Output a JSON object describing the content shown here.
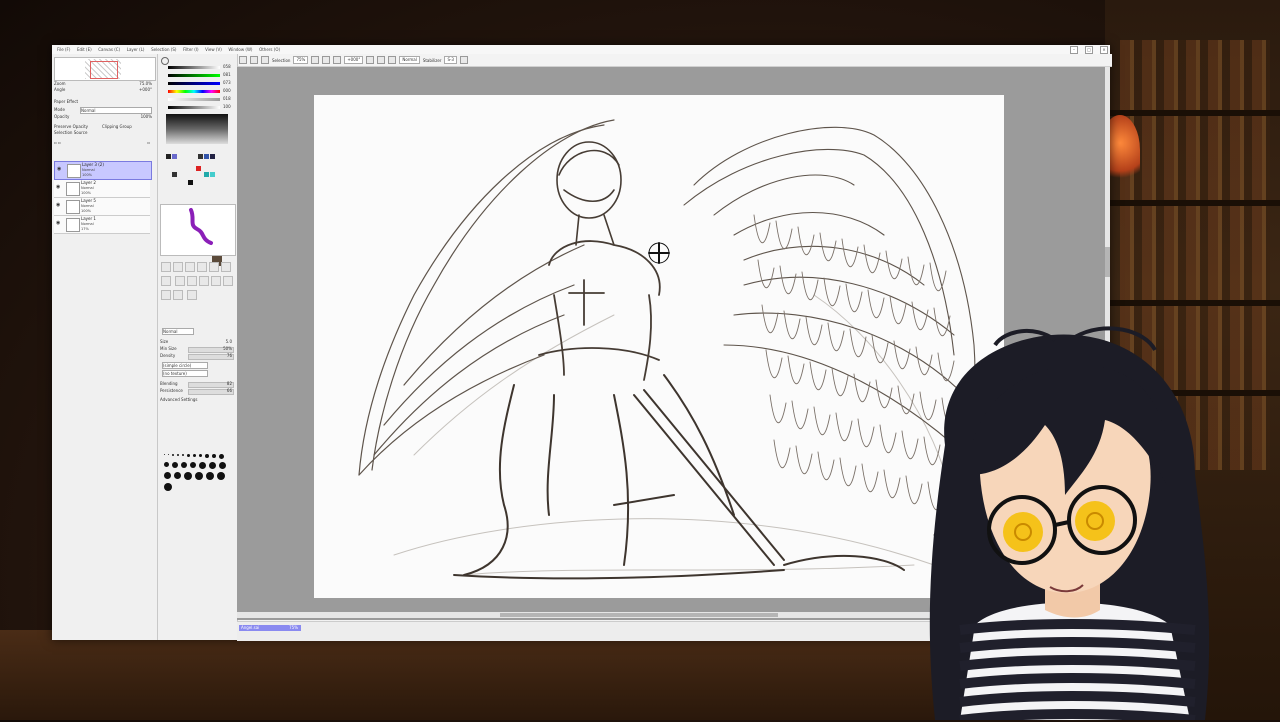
{
  "menu": [
    "File (F)",
    "Edit (E)",
    "Canvas (C)",
    "Layer (L)",
    "Selection (S)",
    "Filter (I)",
    "View (V)",
    "Window (W)",
    "Others (O)"
  ],
  "toolbar": {
    "selection_label": "Selection",
    "zoom_value": "75%",
    "rotation_value": "+000°",
    "mode_value": "Normal",
    "stabilizer_label": "Stabilizer",
    "stabilizer_value": "S-3"
  },
  "navigator": {
    "zoom_label": "Zoom",
    "zoom_value": "75.0%",
    "angle_label": "Angle",
    "angle_value": "+000°"
  },
  "layer_panel": {
    "effect_label": "Paper Effect",
    "mode_label": "Mode",
    "mode_value": "Normal",
    "opacity_label": "Opacity",
    "opacity_value": "100%",
    "preserve_opacity": "Preserve Opacity",
    "clipping_group": "Clipping Group",
    "selection_source": "Selection Source",
    "layers": [
      {
        "name": "Layer 3 (2)",
        "mode": "Normal",
        "opacity": "100%",
        "selected": true
      },
      {
        "name": "Layer 2",
        "mode": "Normal",
        "opacity": "100%",
        "selected": false
      },
      {
        "name": "Layer 5",
        "mode": "Normal",
        "opacity": "100%",
        "selected": false
      },
      {
        "name": "Layer 1",
        "mode": "Normal",
        "opacity": "17%",
        "selected": false
      }
    ]
  },
  "color_panel": {
    "values": [
      "058",
      "081",
      "073",
      "000",
      "018",
      "100"
    ],
    "primary_color": "#5b4a3a",
    "preview_stroke_color": "#8b1fb8"
  },
  "brush": {
    "tools": [
      "Pencil",
      "AirBrush",
      "Brush",
      "Water Color",
      "Marker",
      "Eraser",
      "SelPen",
      "SelErase",
      "Bucket",
      "Legacy",
      "Binary",
      "Blur",
      "Smudge",
      "Dodge",
      "Blender"
    ],
    "mode_value": "Normal",
    "size_label": "Size",
    "size_value": "5.0",
    "min_size_label": "Min Size",
    "min_size_value": "50%",
    "density_label": "Density",
    "density_value": "76",
    "shape_value": "(simple circle)",
    "texture_value": "(no texture)",
    "blending_label": "Blending",
    "blending_value": "82",
    "persistence_label": "Persistence",
    "persistence_value": "66",
    "advanced_label": "Advanced Settings"
  },
  "status": {
    "doc_tab": "Angel.sai",
    "doc_zoom": "75%"
  },
  "colors": {
    "accent": "#8a8af0",
    "canvas_bg": "#9b9b9b",
    "paper": "#fbfbfb",
    "sketch": "#4a4038",
    "hair": "#1a1a22",
    "eye": "#f5c21a"
  }
}
